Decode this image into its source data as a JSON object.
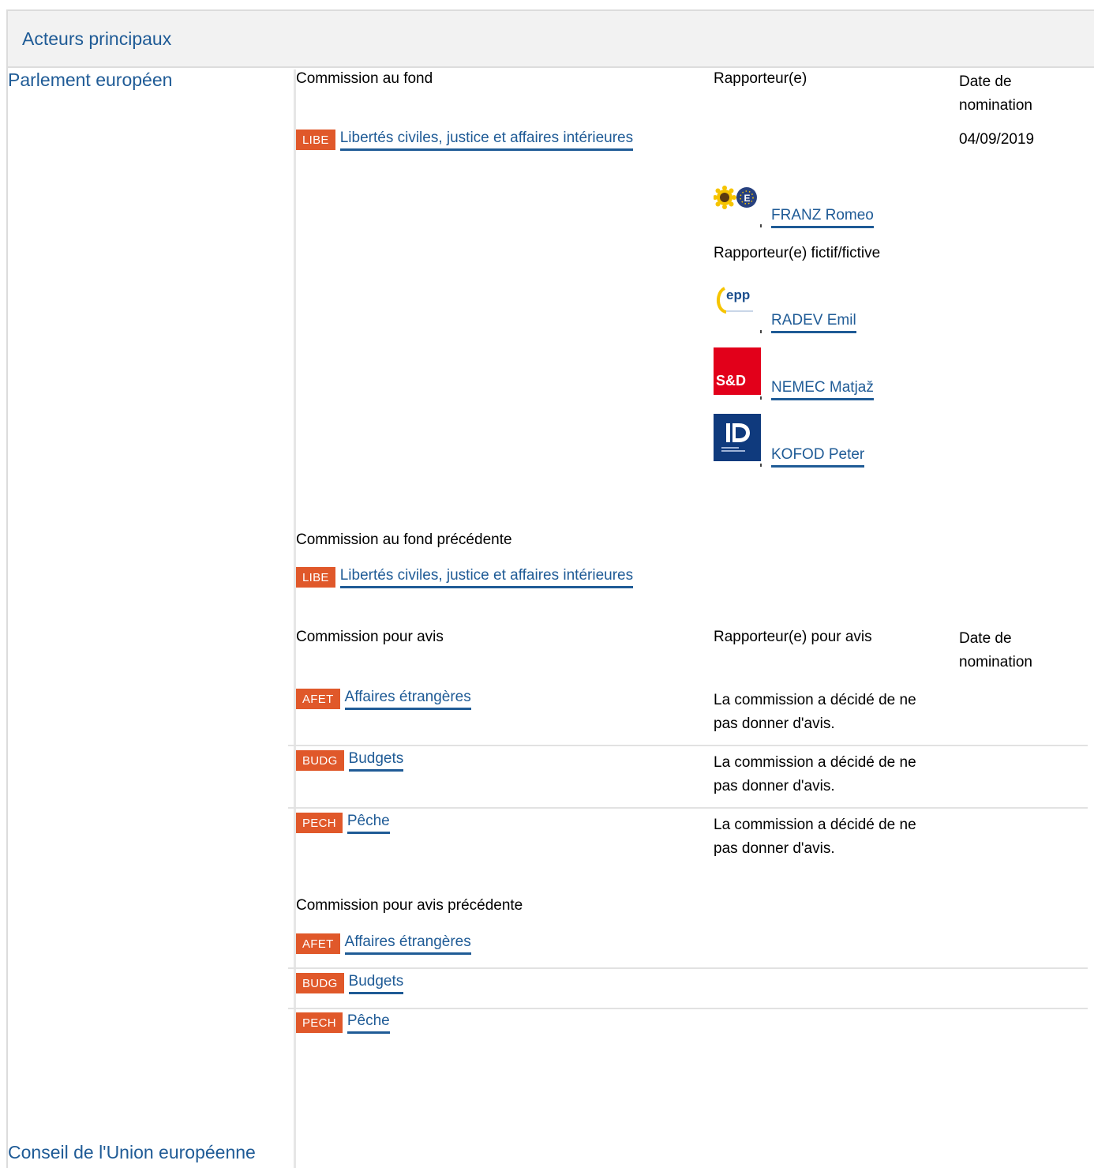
{
  "header": {
    "title": "Acteurs principaux"
  },
  "actors": {
    "parliament": "Parlement européen",
    "council": "Conseil de l'Union européenne"
  },
  "lead": {
    "committee_header": "Commission au fond",
    "rapporteur_header": "Rapporteur(e)",
    "date_header_line1": "Date de",
    "date_header_line2": "nomination",
    "committee": {
      "code": "LIBE",
      "name": "Libertés civiles, justice et affaires intérieures",
      "date": "04/09/2019"
    },
    "rapporteur": {
      "name": "FRANZ Romeo",
      "group": "greens-efa"
    },
    "shadow_header": "Rapporteur(e) fictif/fictive",
    "shadows": [
      {
        "name": "RADEV Emil",
        "group": "epp",
        "logo_text": "epp"
      },
      {
        "name": "NEMEC Matjaž",
        "group": "s-and-d",
        "logo_text": "S&D"
      },
      {
        "name": "KOFOD Peter",
        "group": "id",
        "logo_text": "ID"
      }
    ]
  },
  "previous_lead": {
    "header": "Commission au fond précédente",
    "committee": {
      "code": "LIBE",
      "name": "Libertés civiles, justice et affaires intérieures"
    }
  },
  "opinion": {
    "committee_header": "Commission pour avis",
    "rapporteur_header": "Rapporteur(e) pour avis",
    "date_header_line1": "Date de",
    "date_header_line2": "nomination",
    "rows": [
      {
        "code": "AFET",
        "name": "Affaires étrangères",
        "note_line1": "La commission a décidé de ne",
        "note_line2": "pas donner d'avis."
      },
      {
        "code": "BUDG",
        "name": "Budgets",
        "note_line1": "La commission a décidé de ne",
        "note_line2": "pas donner d'avis."
      },
      {
        "code": "PECH",
        "name": "Pêche",
        "note_line1": "La commission a décidé de ne",
        "note_line2": "pas donner d'avis."
      }
    ]
  },
  "previous_opinion": {
    "header": "Commission pour avis précédente",
    "rows": [
      {
        "code": "AFET",
        "name": "Affaires étrangères"
      },
      {
        "code": "BUDG",
        "name": "Budgets"
      },
      {
        "code": "PECH",
        "name": "Pêche"
      }
    ]
  },
  "colors": {
    "badge": "#e0582a",
    "link": "#1f5b96",
    "header_bg": "#f2f2f2",
    "sd_red": "#e2001a",
    "id_blue": "#0f3a7d"
  }
}
